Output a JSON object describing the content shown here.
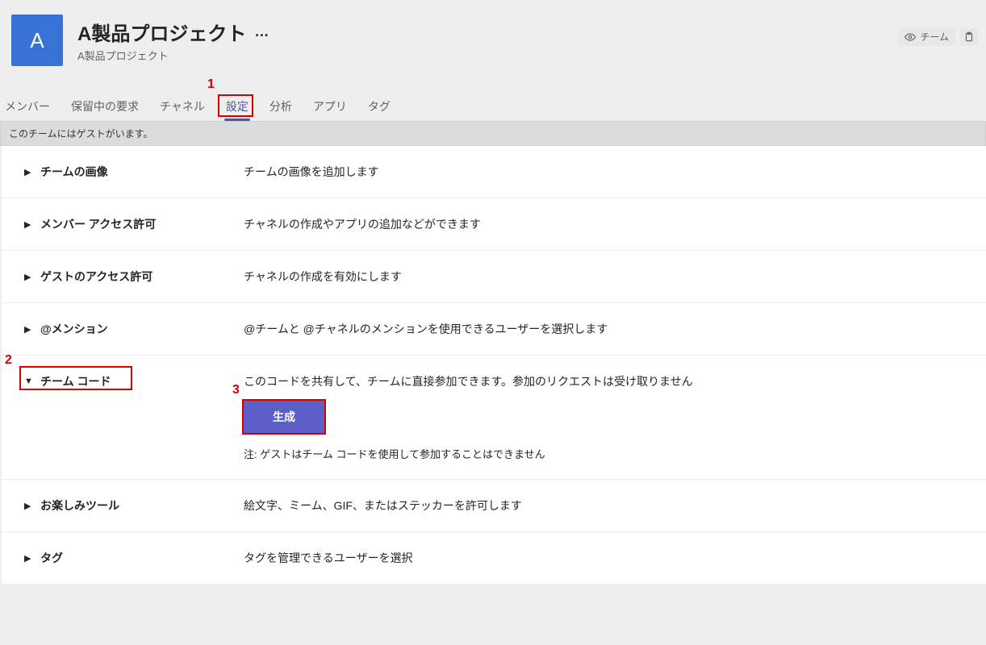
{
  "header": {
    "avatar_letter": "A",
    "title": "A製品プロジェクト",
    "more": "…",
    "subtitle": "A製品プロジェクト",
    "team_chip": "チーム"
  },
  "tabs": [
    {
      "id": "members",
      "label": "メンバー",
      "active": false
    },
    {
      "id": "pending",
      "label": "保留中の要求",
      "active": false
    },
    {
      "id": "channels",
      "label": "チャネル",
      "active": false
    },
    {
      "id": "settings",
      "label": "設定",
      "active": true
    },
    {
      "id": "analytics",
      "label": "分析",
      "active": false
    },
    {
      "id": "apps",
      "label": "アプリ",
      "active": false
    },
    {
      "id": "tags",
      "label": "タグ",
      "active": false
    }
  ],
  "guest_notice": "このチームにはゲストがいます。",
  "sections": {
    "teamImage": {
      "label": "チームの画像",
      "desc": "チームの画像を追加します"
    },
    "memberPerm": {
      "label": "メンバー アクセス許可",
      "desc": "チャネルの作成やアプリの追加などができます"
    },
    "guestPerm": {
      "label": "ゲストのアクセス許可",
      "desc": "チャネルの作成を有効にします"
    },
    "mentions": {
      "label": "@メンション",
      "desc": "@チームと @チャネルのメンションを使用できるユーザーを選択します"
    },
    "teamCode": {
      "label": "チーム コード",
      "desc": "このコードを共有して、チームに直接参加できます。参加のリクエストは受け取りません",
      "button": "生成",
      "note": "注: ゲストはチーム コードを使用して参加することはできません"
    },
    "fun": {
      "label": "お楽しみツール",
      "desc": "絵文字、ミーム、GIF、またはステッカーを許可します"
    },
    "tags": {
      "label": "タグ",
      "desc": "タグを管理できるユーザーを選択"
    }
  },
  "annotations": {
    "a1": "1",
    "a2": "2",
    "a3": "3"
  }
}
